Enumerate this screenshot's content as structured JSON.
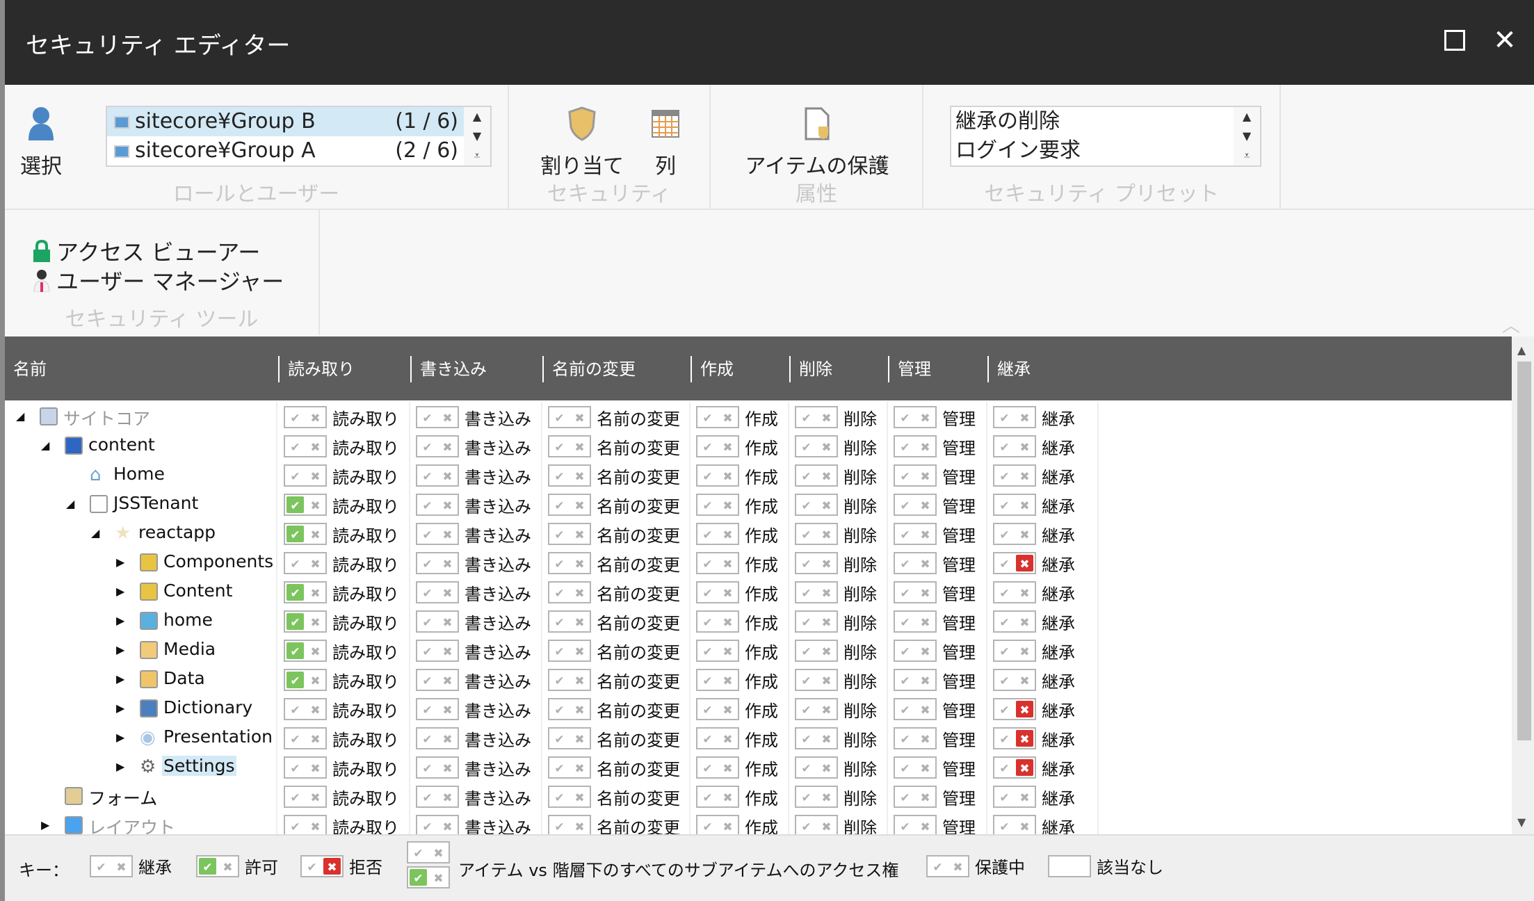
{
  "window": {
    "title": "セキュリティ エディター",
    "maximize_icon": "maximize-icon",
    "close_icon": "close-icon"
  },
  "ribbon": {
    "roles_group": {
      "label": "ロールとユーザー",
      "select_label": "選択",
      "list": [
        {
          "name": "sitecore¥Group B",
          "count": "(1 / 6)",
          "selected": true
        },
        {
          "name": "sitecore¥Group A",
          "count": "(2 / 6)",
          "selected": false
        }
      ]
    },
    "security_group": {
      "label": "セキュリティ",
      "assign_label": "割り当て",
      "columns_label": "列"
    },
    "attributes_group": {
      "label": "属性",
      "protect_label": "アイテムの保護"
    },
    "presets_group": {
      "label": "セキュリティ プリセット",
      "items": [
        "継承の削除",
        "ログイン要求"
      ]
    },
    "tools_group": {
      "label": "セキュリティ ツール",
      "access_viewer": "アクセス ビューアー",
      "user_manager": "ユーザー マネージャー"
    }
  },
  "grid": {
    "name_header": "名前",
    "columns": [
      {
        "header": "読み取り",
        "cell_label": "読み取り"
      },
      {
        "header": "書き込み",
        "cell_label": "書き込み"
      },
      {
        "header": "名前の変更",
        "cell_label": "名前の変更"
      },
      {
        "header": "作成",
        "cell_label": "作成"
      },
      {
        "header": "削除",
        "cell_label": "削除"
      },
      {
        "header": "管理",
        "cell_label": "管理"
      },
      {
        "header": "継承",
        "cell_label": "継承"
      }
    ],
    "rows": [
      {
        "name": "サイトコア",
        "level": 0,
        "expander": "open",
        "icon": "document-icon",
        "muted": true,
        "states": [
          "inherit",
          "inherit",
          "inherit",
          "inherit",
          "inherit",
          "inherit",
          "inherit"
        ]
      },
      {
        "name": "content",
        "level": 1,
        "expander": "open",
        "icon": "content-cubes-icon",
        "states": [
          "inherit",
          "inherit",
          "inherit",
          "inherit",
          "inherit",
          "inherit",
          "inherit"
        ]
      },
      {
        "name": "Home",
        "level": 2,
        "expander": "none",
        "icon": "home-icon",
        "states": [
          "inherit",
          "inherit",
          "inherit",
          "inherit",
          "inherit",
          "inherit",
          "inherit"
        ]
      },
      {
        "name": "JSSTenant",
        "level": 2,
        "expander": "open",
        "icon": "window-icon",
        "states": [
          "allow",
          "inherit",
          "inherit",
          "inherit",
          "inherit",
          "inherit",
          "inherit"
        ]
      },
      {
        "name": "reactapp",
        "level": 3,
        "expander": "open",
        "icon": "site-star-icon",
        "states": [
          "allow",
          "inherit",
          "inherit",
          "inherit",
          "inherit",
          "inherit",
          "inherit"
        ]
      },
      {
        "name": "Components",
        "level": 4,
        "expander": "closed",
        "icon": "folder-icon",
        "states": [
          "inherit",
          "inherit",
          "inherit",
          "inherit",
          "inherit",
          "inherit",
          "deny"
        ]
      },
      {
        "name": "Content",
        "level": 4,
        "expander": "closed",
        "icon": "folder-icon",
        "states": [
          "allow",
          "inherit",
          "inherit",
          "inherit",
          "inherit",
          "inherit",
          "inherit"
        ]
      },
      {
        "name": "home",
        "level": 4,
        "expander": "closed",
        "icon": "route-icon",
        "states": [
          "allow",
          "inherit",
          "inherit",
          "inherit",
          "inherit",
          "inherit",
          "inherit"
        ]
      },
      {
        "name": "Media",
        "level": 4,
        "expander": "closed",
        "icon": "media-folder-icon",
        "states": [
          "allow",
          "inherit",
          "inherit",
          "inherit",
          "inherit",
          "inherit",
          "inherit"
        ]
      },
      {
        "name": "Data",
        "level": 4,
        "expander": "closed",
        "icon": "data-icon",
        "states": [
          "allow",
          "inherit",
          "inherit",
          "inherit",
          "inherit",
          "inherit",
          "inherit"
        ]
      },
      {
        "name": "Dictionary",
        "level": 4,
        "expander": "closed",
        "icon": "book-icon",
        "states": [
          "inherit",
          "inherit",
          "inherit",
          "inherit",
          "inherit",
          "inherit",
          "deny"
        ]
      },
      {
        "name": "Presentation",
        "level": 4,
        "expander": "closed",
        "icon": "eye-icon",
        "states": [
          "inherit",
          "inherit",
          "inherit",
          "inherit",
          "inherit",
          "inherit",
          "deny"
        ]
      },
      {
        "name": "Settings",
        "level": 4,
        "expander": "closed",
        "icon": "gear-icon",
        "selected": true,
        "states": [
          "inherit",
          "inherit",
          "inherit",
          "inherit",
          "inherit",
          "inherit",
          "deny"
        ]
      },
      {
        "name": "フォーム",
        "level": 1,
        "expander": "none",
        "icon": "form-icon",
        "states": [
          "inherit",
          "inherit",
          "inherit",
          "inherit",
          "inherit",
          "inherit",
          "inherit"
        ]
      },
      {
        "name": "レイアウト",
        "level": 1,
        "expander": "closed",
        "icon": "layout-icon",
        "muted": true,
        "states": [
          "inherit",
          "inherit",
          "inherit",
          "inherit",
          "inherit",
          "inherit",
          "inherit"
        ]
      }
    ]
  },
  "legend": {
    "key_label": "キー：",
    "inherit": "継承",
    "allow": "許可",
    "deny": "拒否",
    "item_vs_descendants": "アイテム vs 階層下のすべてのサブアイテムへのアクセス権",
    "protected": "保護中",
    "not_applicable": "該当なし"
  },
  "colors": {
    "allow": "#7cc45d",
    "deny": "#d9312d",
    "titlebar": "#2b2b2b",
    "grid_header": "#5d5d5d",
    "selection": "#d3e9f5"
  }
}
